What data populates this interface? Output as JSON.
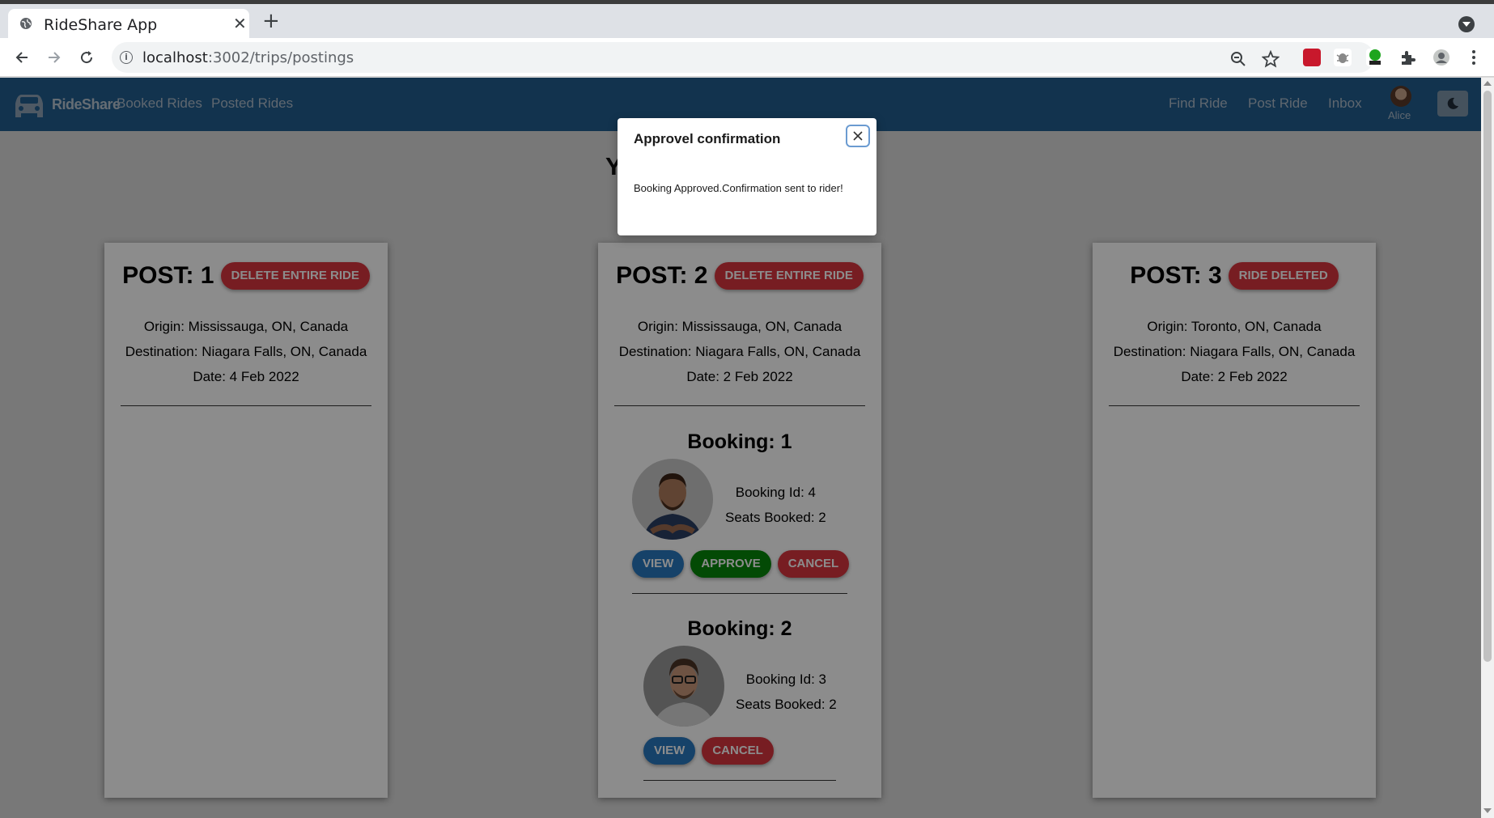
{
  "browser": {
    "tab_title": "RideShare App",
    "url_host": "localhost",
    "url_path": ":3002/trips/postings"
  },
  "nav": {
    "brand": "RideShare",
    "links_left": [
      "Booked Rides",
      "Posted Rides"
    ],
    "links_right": [
      "Find Ride",
      "Post Ride",
      "Inbox"
    ],
    "user_name": "Alice"
  },
  "page": {
    "heading_partial": "Y"
  },
  "posts": [
    {
      "title": "POST: 1",
      "action_label": "DELETE ENTIRE RIDE",
      "origin": "Origin: Mississauga, ON, Canada",
      "destination": "Destination: Niagara Falls, ON, Canada",
      "date": "Date: 4 Feb 2022"
    },
    {
      "title": "POST: 2",
      "action_label": "DELETE ENTIRE RIDE",
      "origin": "Origin: Mississauga, ON, Canada",
      "destination": "Destination: Niagara Falls, ON, Canada",
      "date": "Date: 2 Feb 2022",
      "bookings": [
        {
          "title": "Booking: 1",
          "booking_id": "Booking Id: 4",
          "seats": "Seats Booked: 2",
          "view_label": "VIEW",
          "approve_label": "APPROVE",
          "cancel_label": "CANCEL"
        },
        {
          "title": "Booking: 2",
          "booking_id": "Booking Id: 3",
          "seats": "Seats Booked: 2",
          "view_label": "VIEW",
          "cancel_label": "CANCEL"
        }
      ]
    },
    {
      "title": "POST: 3",
      "action_label": "RIDE DELETED",
      "origin": "Origin: Toronto, ON, Canada",
      "destination": "Destination: Niagara Falls, ON, Canada",
      "date": "Date: 2 Feb 2022"
    }
  ],
  "modal": {
    "title": "Approvel confirmation",
    "message": "Booking Approved.Confirmation sent to rider!"
  },
  "colors": {
    "navbar": "#215d8e",
    "danger": "#d9363e",
    "primary": "#2878c0",
    "success": "#06880a"
  }
}
